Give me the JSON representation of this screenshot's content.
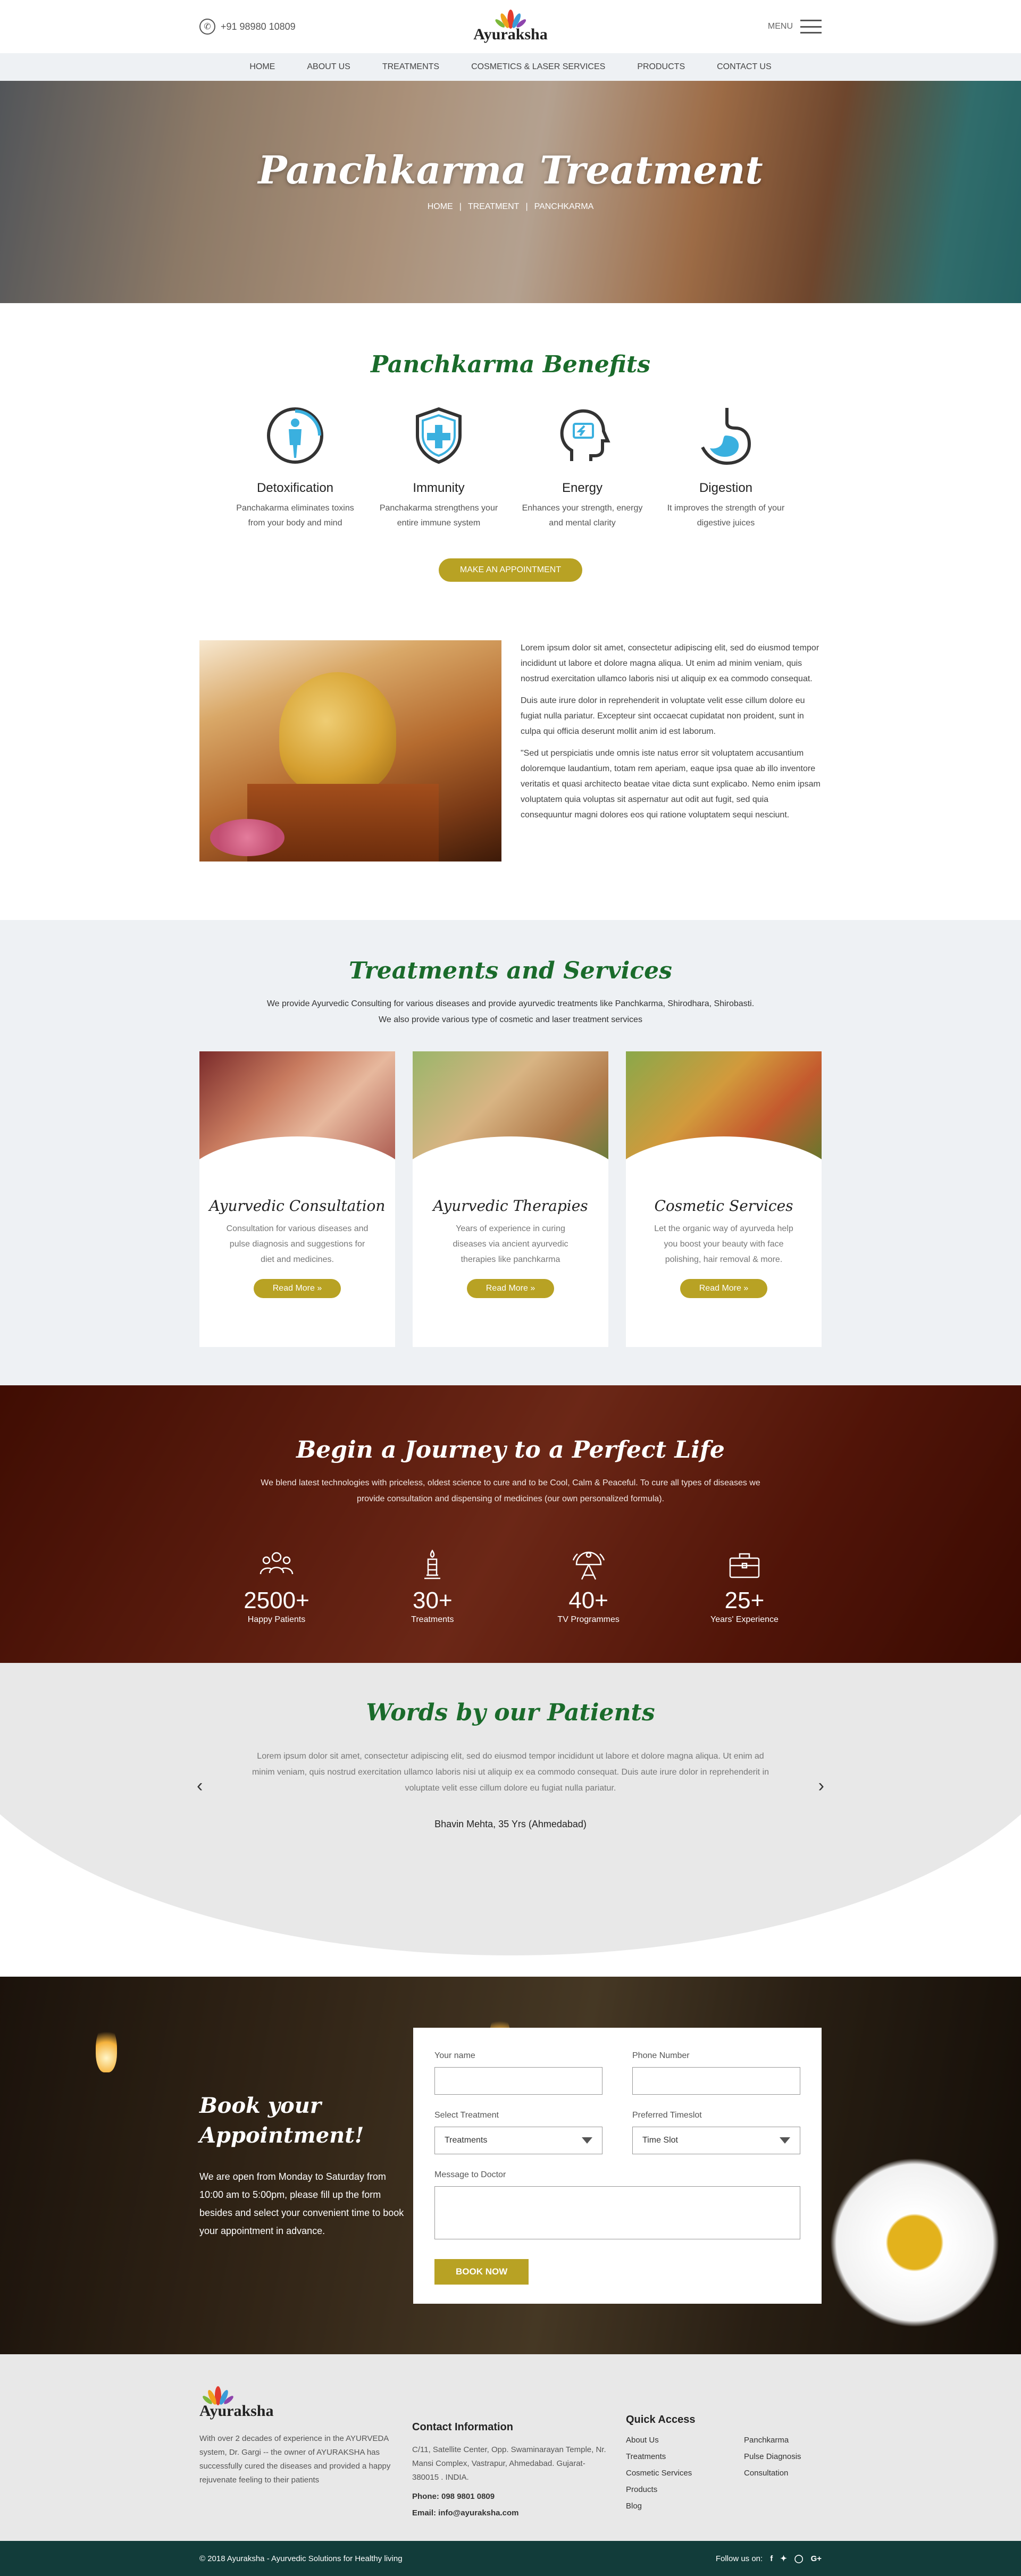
{
  "header": {
    "phone": "+91 98980 10809",
    "logo_text": "Ayuraksha",
    "menu_label": "MENU"
  },
  "nav": [
    "HOME",
    "ABOUT US",
    "TREATMENTS",
    "COSMETICS & LASER SERVICES",
    "PRODUCTS",
    "CONTACT US"
  ],
  "hero": {
    "title": "Panchkarma Treatment",
    "breadcrumb": [
      "HOME",
      "|",
      "TREATMENT",
      "|",
      "PANCHKARMA"
    ]
  },
  "benefits": {
    "title": "Panchkarma Benefits",
    "items": [
      {
        "title": "Detoxification",
        "text": "Panchakarma eliminates toxins from your body and mind",
        "icon": "body-icon"
      },
      {
        "title": "Immunity",
        "text": "Panchakarma strengthens your entire immune system",
        "icon": "shield-plus-icon"
      },
      {
        "title": "Energy",
        "text": "Enhances your strength, energy and mental clarity",
        "icon": "head-battery-icon"
      },
      {
        "title": "Digestion",
        "text": "It improves the strength of your digestive juices",
        "icon": "stomach-icon"
      }
    ],
    "cta": "MAKE AN APPOINTMENT"
  },
  "about": {
    "paragraphs": [
      "Lorem ipsum dolor sit amet, consectetur adipiscing elit, sed do eiusmod tempor incididunt ut labore et dolore magna aliqua. Ut enim ad minim veniam, quis nostrud exercitation ullamco laboris nisi ut aliquip ex ea commodo consequat.",
      "Duis aute irure dolor in reprehenderit in voluptate velit esse cillum dolore eu fugiat nulla pariatur. Excepteur sint occaecat cupidatat non proident, sunt in culpa qui officia deserunt mollit anim id est laborum.",
      "\"Sed ut perspiciatis unde omnis iste natus error sit voluptatem accusantium doloremque laudantium, totam rem aperiam, eaque ipsa quae ab illo inventore veritatis et quasi architecto beatae vitae dicta sunt explicabo. Nemo enim ipsam voluptatem quia voluptas sit aspernatur aut odit aut fugit, sed quia consequuntur magni dolores eos qui ratione voluptatem sequi nesciunt."
    ]
  },
  "treatments": {
    "title": "Treatments and Services",
    "intro_line1": "We provide Ayurvedic Consulting for various diseases and provide ayurvedic treatments like Panchkarma, Shirodhara, Shirobasti.",
    "intro_line2": "We also provide various type of cosmetic and laser treatment services",
    "cards": [
      {
        "title": "Ayurvedic Consultation",
        "text": "Consultation for various diseases and pulse diagnosis and suggestions for diet and medicines.",
        "button": "Read More »"
      },
      {
        "title": "Ayurvedic Therapies",
        "text": "Years of experience in curing diseases via ancient ayurvedic therapies like panchkarma",
        "button": "Read More »"
      },
      {
        "title": "Cosmetic Services",
        "text": "Let the organic way of ayurveda help you boost your beauty with face polishing, hair removal & more.",
        "button": "Read More »"
      }
    ]
  },
  "journey": {
    "title": "Begin a Journey to a Perfect Life",
    "intro_line1": "We blend latest technologies with priceless, oldest science to cure and to be Cool, Calm & Peaceful.  To cure all types of diseases we",
    "intro_line2": "provide consultation and dispensing of medicines (our own personalized formula).",
    "stats": [
      {
        "value": "2500+",
        "label": "Happy Patients",
        "icon": "people-group-icon"
      },
      {
        "value": "30+",
        "label": "Treatments",
        "icon": "candle-icon"
      },
      {
        "value": "40+",
        "label": "TV Programmes",
        "icon": "satellite-dish-icon"
      },
      {
        "value": "25+",
        "label": "Years' Experience",
        "icon": "briefcase-icon"
      }
    ]
  },
  "testimonials": {
    "title": "Words by our Patients",
    "quote": "Lorem ipsum dolor sit amet, consectetur adipiscing elit, sed do eiusmod tempor incididunt ut labore et dolore magna aliqua. Ut enim ad minim veniam, quis nostrud exercitation ullamco laboris nisi ut aliquip ex ea commodo consequat. Duis aute irure dolor in reprehenderit in voluptate velit esse cillum dolore eu fugiat nulla pariatur.",
    "author": "Bhavin Mehta, 35 Yrs (Ahmedabad)"
  },
  "booking": {
    "title_line1": "Book your",
    "title_line2": "Appointment!",
    "text": "We are open from Monday to Saturday from 10:00 am to 5:00pm, please fill up the form besides and select your convenient time to book your appointment in advance.",
    "name_label": "Your name",
    "phone_label": "Phone Number",
    "treatment_label": "Select Treatment",
    "treatment_value": "Treatments",
    "timeslot_label": "Preferred Timeslot",
    "timeslot_value": "Time Slot",
    "message_label": "Message to Doctor",
    "button": "BOOK NOW"
  },
  "footer": {
    "logo_text": "Ayuraksha",
    "about": "With over 2 decades of experience in the AYURVEDA system, Dr. Gargi -- the owner of AYURAKSHA has successfully cured the diseases and provided a happy rejuvenate feeling to their patients",
    "contact_title": "Contact Information",
    "address": "C/11, Satellite Center, Opp. Swaminarayan Temple, Nr. Mansi Complex, Vastrapur, Ahmedabad. Gujarat-380015 . INDIA.",
    "phone": "Phone: 098 9801 0809",
    "email": "Email: info@ayuraksha.com",
    "quick_title": "Quick Access",
    "links": [
      "About Us",
      "Panchkarma",
      "Treatments",
      "Pulse Diagnosis",
      "Cosmetic Services",
      "Consultation",
      "Products",
      "",
      "Blog",
      ""
    ],
    "copyright": "© 2018 Ayuraksha - Ayurvedic Solutions for Healthy living",
    "follow": "Follow us on:",
    "social": [
      "f",
      "t",
      "ig",
      "G+"
    ]
  },
  "colors": {
    "accent": "#b8a224",
    "heading_green": "#1a6b2b",
    "footer_bar": "#123c3a",
    "light_bg": "#eef1f4"
  }
}
